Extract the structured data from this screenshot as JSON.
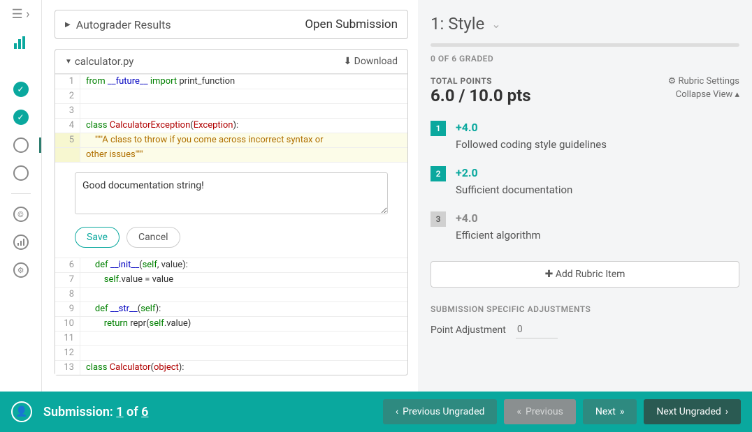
{
  "autograder": {
    "title": "Autograder Results",
    "open": "Open Submission"
  },
  "file": {
    "name": "calculator.py",
    "download": "Download"
  },
  "code": {
    "lines": [
      {
        "n": 1,
        "html": "<span class='kw'>from</span> <span class='nm'>__future__</span> <span class='kw'>import</span> print_function"
      },
      {
        "n": 2,
        "html": ""
      },
      {
        "n": 3,
        "html": ""
      },
      {
        "n": 4,
        "html": "<span class='kw'>class</span> <span class='cls'>CalculatorException</span>(<span class='cls'>Exception</span>):"
      },
      {
        "n": 5,
        "html": "    <span class='str'>\"\"\"A class to throw if you come across incorrect syntax or</span>",
        "hl": true,
        "wrap": "<span class='str'>other issues\"\"\"</span>"
      }
    ],
    "lines2": [
      {
        "n": 6,
        "html": "    <span class='kw'>def</span> <span class='nm'>__init__</span>(<span class='kw'>self</span>, value):"
      },
      {
        "n": 7,
        "html": "        <span class='kw'>self</span>.value = value"
      },
      {
        "n": 8,
        "html": ""
      },
      {
        "n": 9,
        "html": "    <span class='kw'>def</span> <span class='nm'>__str__</span>(<span class='kw'>self</span>):"
      },
      {
        "n": 10,
        "html": "        <span class='kw'>return</span> repr(<span class='kw'>self</span>.value)"
      },
      {
        "n": 11,
        "html": ""
      },
      {
        "n": 12,
        "html": ""
      },
      {
        "n": 13,
        "html": "<span class='kw'>class</span> <span class='cls'>Calculator</span>(<span class='cls'>object</span>):"
      }
    ]
  },
  "comment": {
    "text": "Good documentation string!",
    "save": "Save",
    "cancel": "Cancel"
  },
  "question": {
    "prefix": "1:",
    "name": "Style",
    "progress_label": "0 OF 6 GRADED",
    "tp_label": "TOTAL POINTS",
    "tp_score": "6.0 / 10.0 pts",
    "settings": "Rubric Settings",
    "collapse": "Collapse View"
  },
  "rubric": [
    {
      "num": "1",
      "pts": "+4.0",
      "desc": "Followed coding style guidelines",
      "active": true
    },
    {
      "num": "2",
      "pts": "+2.0",
      "desc": "Sufficient documentation",
      "active": true
    },
    {
      "num": "3",
      "pts": "+4.0",
      "desc": "Efficient algorithm",
      "active": false
    }
  ],
  "add_item": "Add Rubric Item",
  "adjust": {
    "heading": "SUBMISSION SPECIFIC ADJUSTMENTS",
    "label": "Point Adjustment",
    "placeholder": "0"
  },
  "footer": {
    "label_prefix": "Submission: ",
    "current": "1",
    "of": " of ",
    "total": "6",
    "prev_ungraded": "Previous Ungraded",
    "previous": "Previous",
    "next": "Next",
    "next_ungraded": "Next Ungraded"
  }
}
